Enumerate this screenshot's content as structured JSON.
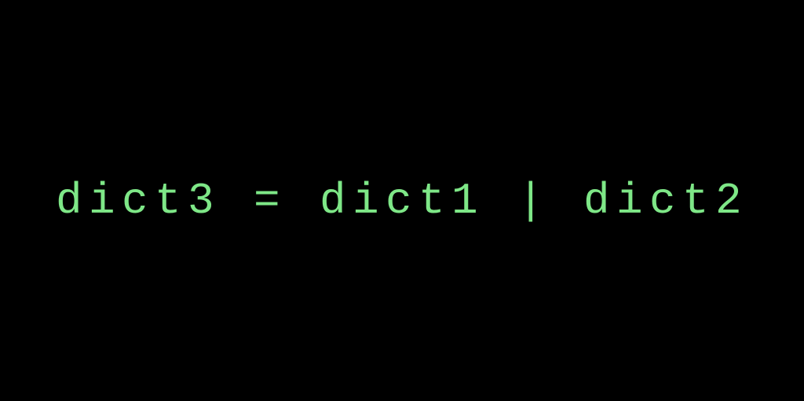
{
  "code": {
    "line": "dict3 = dict1 | dict2"
  },
  "colors": {
    "background": "#000000",
    "text": "#7ee787"
  }
}
